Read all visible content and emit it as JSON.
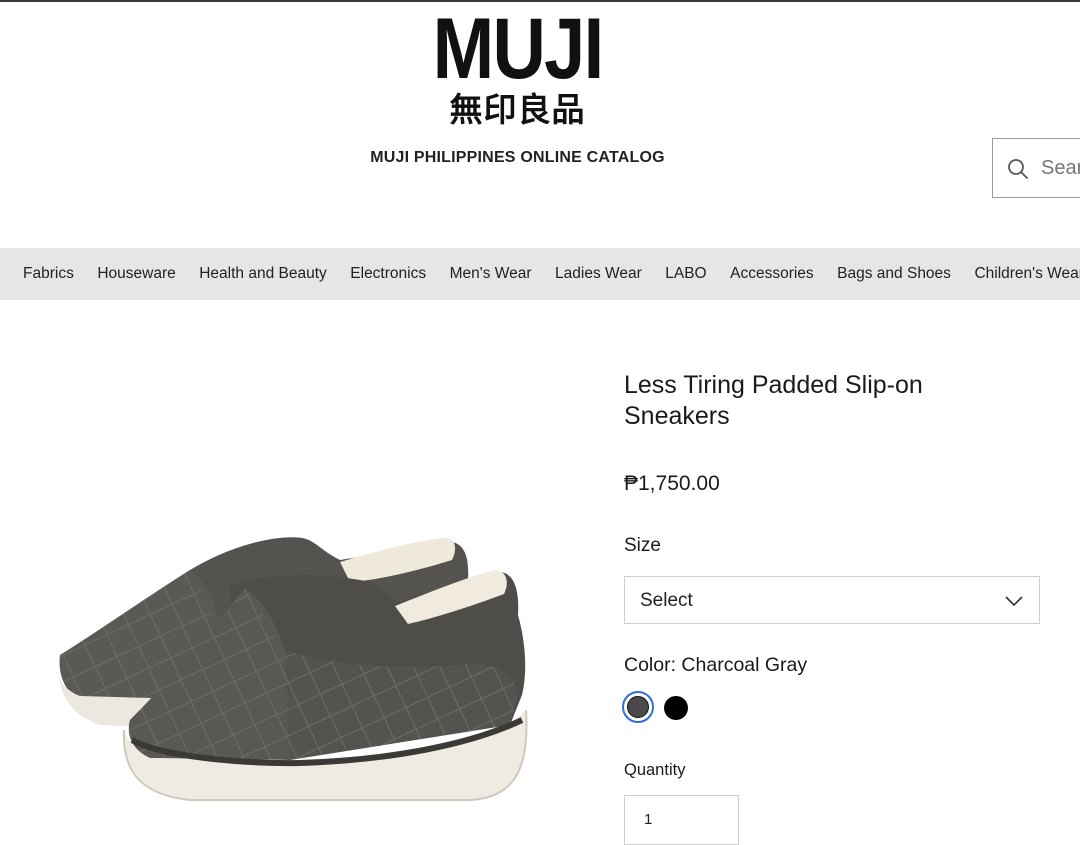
{
  "header": {
    "logo_word": "MUJI",
    "logo_kanji": "無印良品",
    "catalog_title": "MUJI PHILIPPINES ONLINE CATALOG"
  },
  "search": {
    "placeholder": "Search",
    "icon": "search-icon"
  },
  "nav": {
    "items": [
      {
        "label": "Fabrics"
      },
      {
        "label": "Houseware"
      },
      {
        "label": "Health and Beauty"
      },
      {
        "label": "Electronics"
      },
      {
        "label": "Men's Wear"
      },
      {
        "label": "Ladies Wear"
      },
      {
        "label": "LABO"
      },
      {
        "label": "Accessories"
      },
      {
        "label": "Bags and Shoes"
      },
      {
        "label": "Children's Wear"
      }
    ]
  },
  "product": {
    "title": "Less Tiring Padded Slip-on Sneakers",
    "price": "₱1,750.00",
    "size_label": "Size",
    "size_selected": "Select",
    "color_label": "Color: Charcoal Gray",
    "swatches": [
      {
        "name": "Charcoal Gray",
        "hex": "#4a4a4a",
        "selected": true
      },
      {
        "name": "Black",
        "hex": "#000000",
        "selected": false
      }
    ],
    "quantity_label": "Quantity",
    "quantity_value": "1"
  },
  "colors": {
    "nav_background": "#e6e6e6",
    "selected_swatch_ring": "#2f6fd6"
  }
}
